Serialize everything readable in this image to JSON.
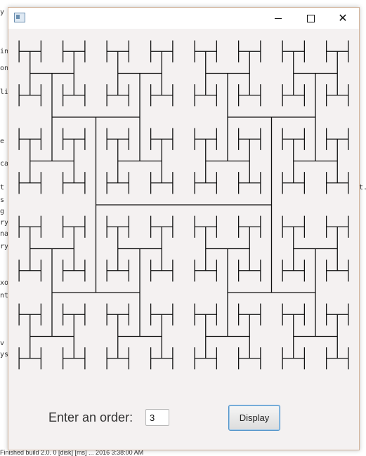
{
  "background": {
    "editor_fragments": [
      "y",
      "in",
      "on",
      "li",
      "e",
      "ca",
      "t",
      "s",
      "g",
      "ry",
      "na",
      "ry",
      "xo",
      "nt",
      "v",
      "ys"
    ],
    "right_fragment": "t.",
    "bottom_text": "Finished build 2.0. 0 [disk] [ms] ... 2016 3:38:00 AM"
  },
  "window": {
    "min_label": "",
    "max_label": "",
    "close_label": "✕"
  },
  "controls": {
    "order_label": "Enter an order:",
    "order_value": "3",
    "display_label": "Display"
  },
  "fractal": {
    "name": "H-tree",
    "order": 3,
    "stroke": "#111111"
  }
}
